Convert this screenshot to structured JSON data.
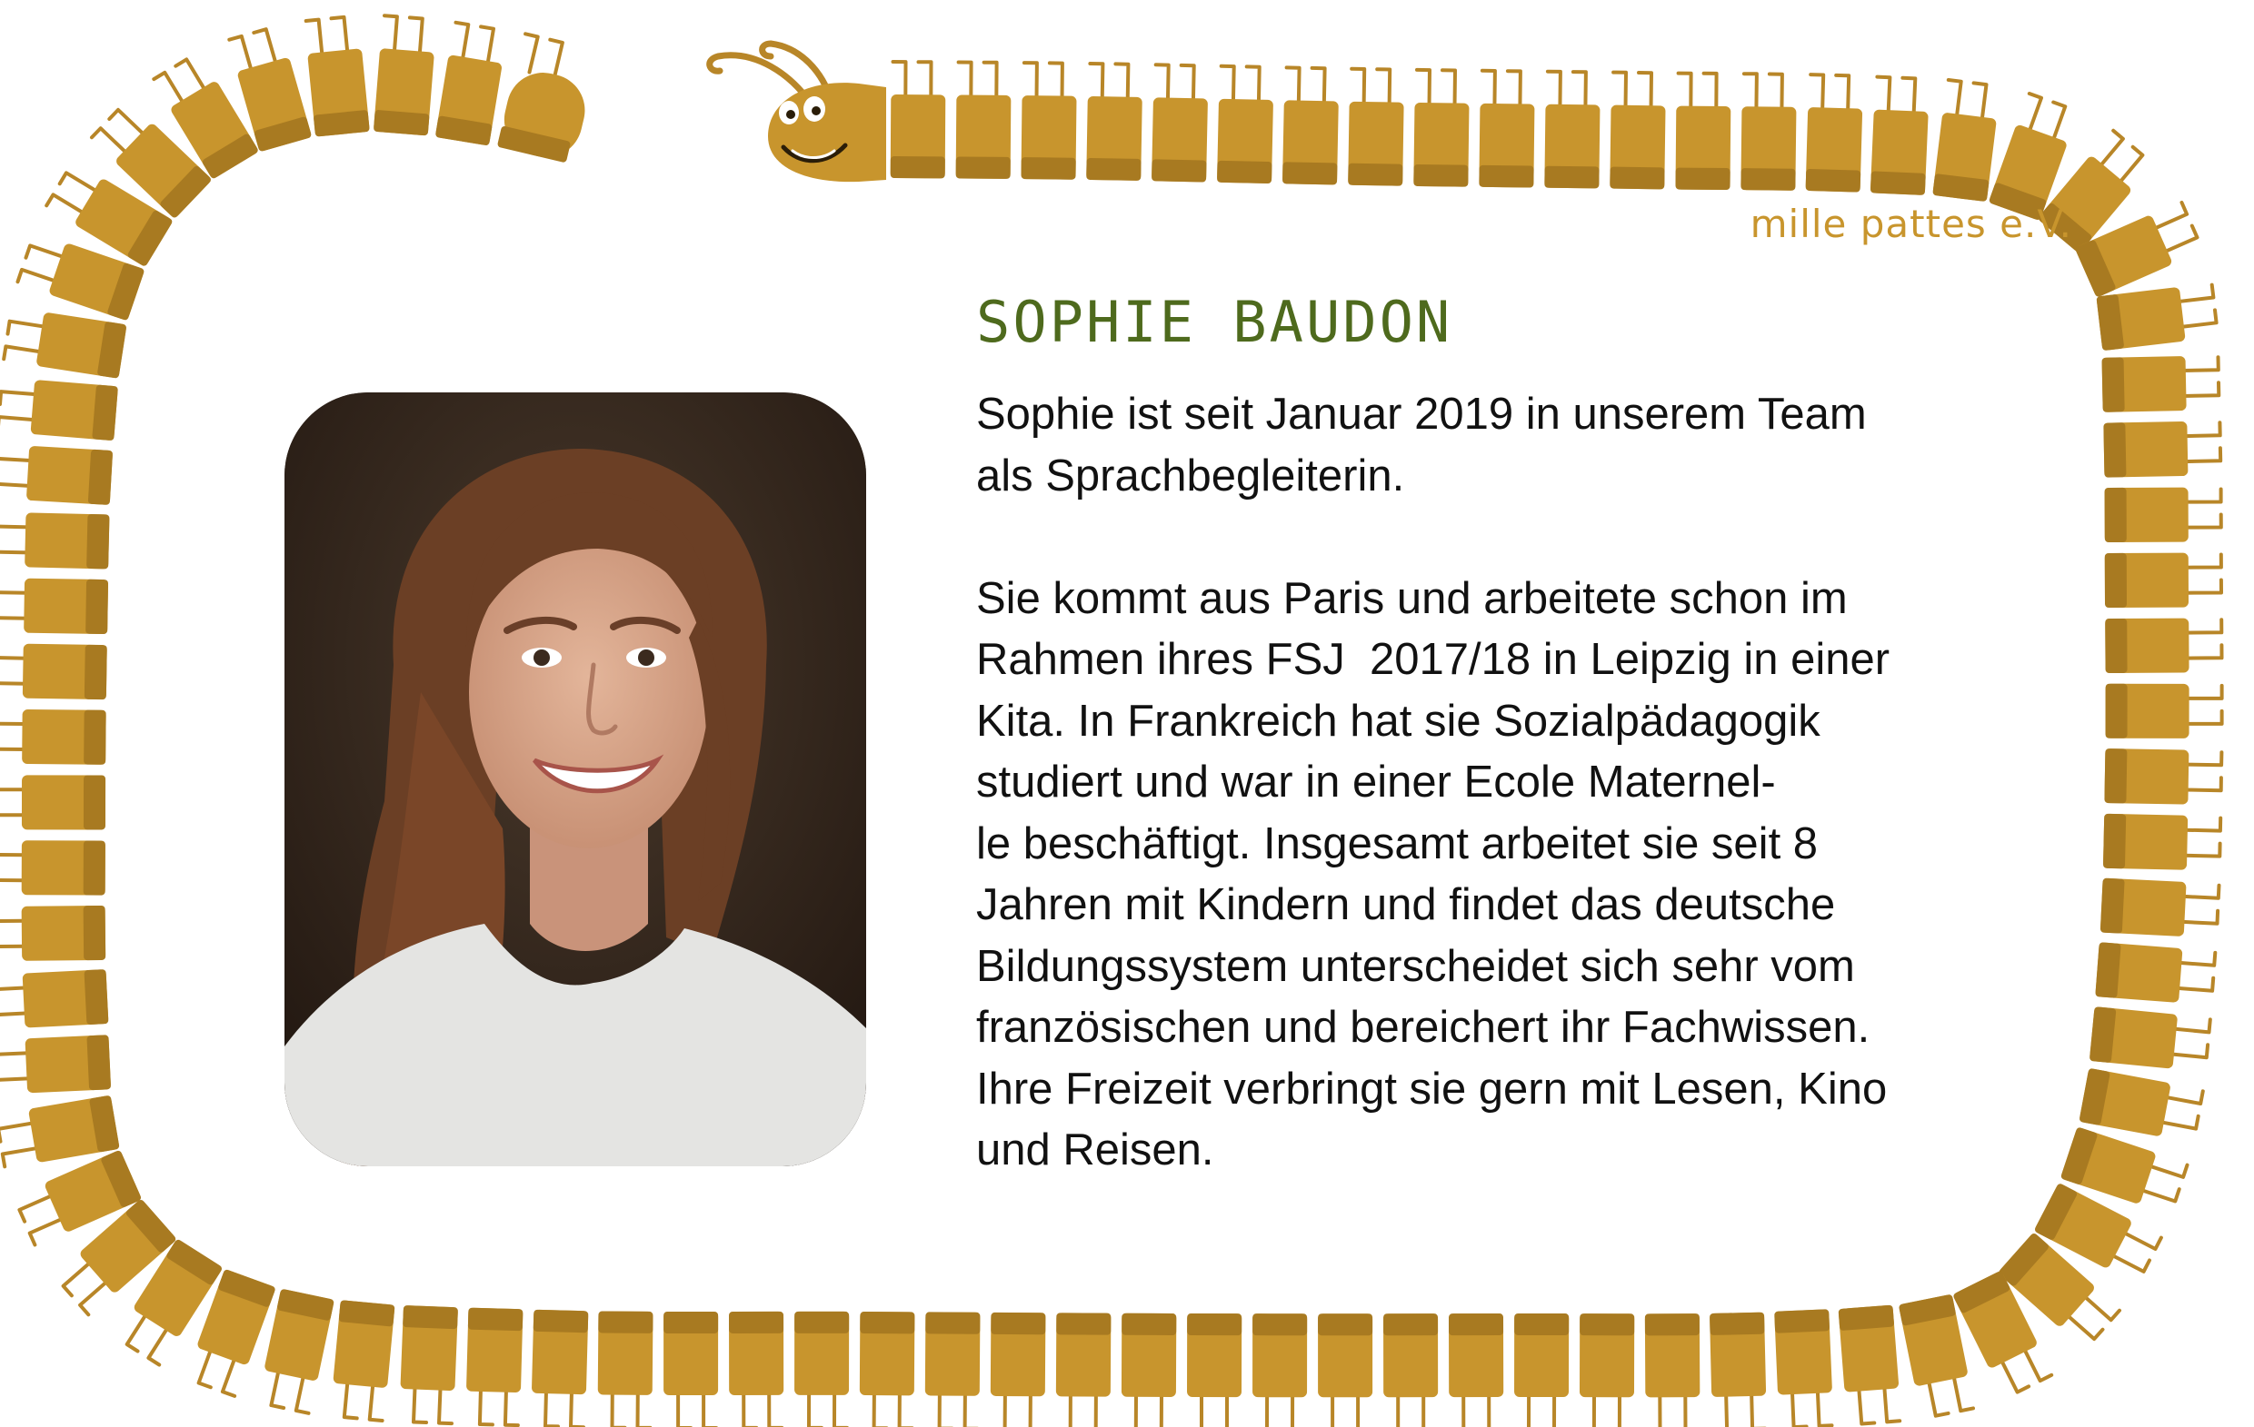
{
  "org": {
    "name": "mille pattes e.V."
  },
  "person": {
    "name": "SOPHIE BAUDON",
    "photo_icon": "portrait-photo"
  },
  "bio": {
    "lines": [
      "Sophie ist seit Januar 2019 in unserem Team",
      "als Sprachbegleiterin.",
      "",
      "Sie kommt aus Paris und arbeitete schon im",
      "Rahmen ihres FSJ  2017/18 in Leipzig in einer",
      "Kita. In Frankreich hat sie Sozialpädagogik",
      "studiert und war in einer Ecole Maternel-",
      "le beschäftigt. Insgesamt arbeitet sie seit 8",
      "Jahren mit Kindern und findet das deutsche",
      "Bildungssystem unterscheidet sich sehr vom",
      "französischen und bereichert ihr Fachwissen.",
      "Ihre Freizeit verbringt sie gern mit Lesen, Kino",
      "und Reisen."
    ]
  },
  "colors": {
    "centipede_body": "#c8952d",
    "centipede_shade": "#a87a21",
    "centipede_legs": "#b88628",
    "name_green": "#4e6a1d",
    "text": "#111111"
  },
  "icons": {
    "frame": "centipede-frame-icon",
    "head": "centipede-head-icon"
  }
}
